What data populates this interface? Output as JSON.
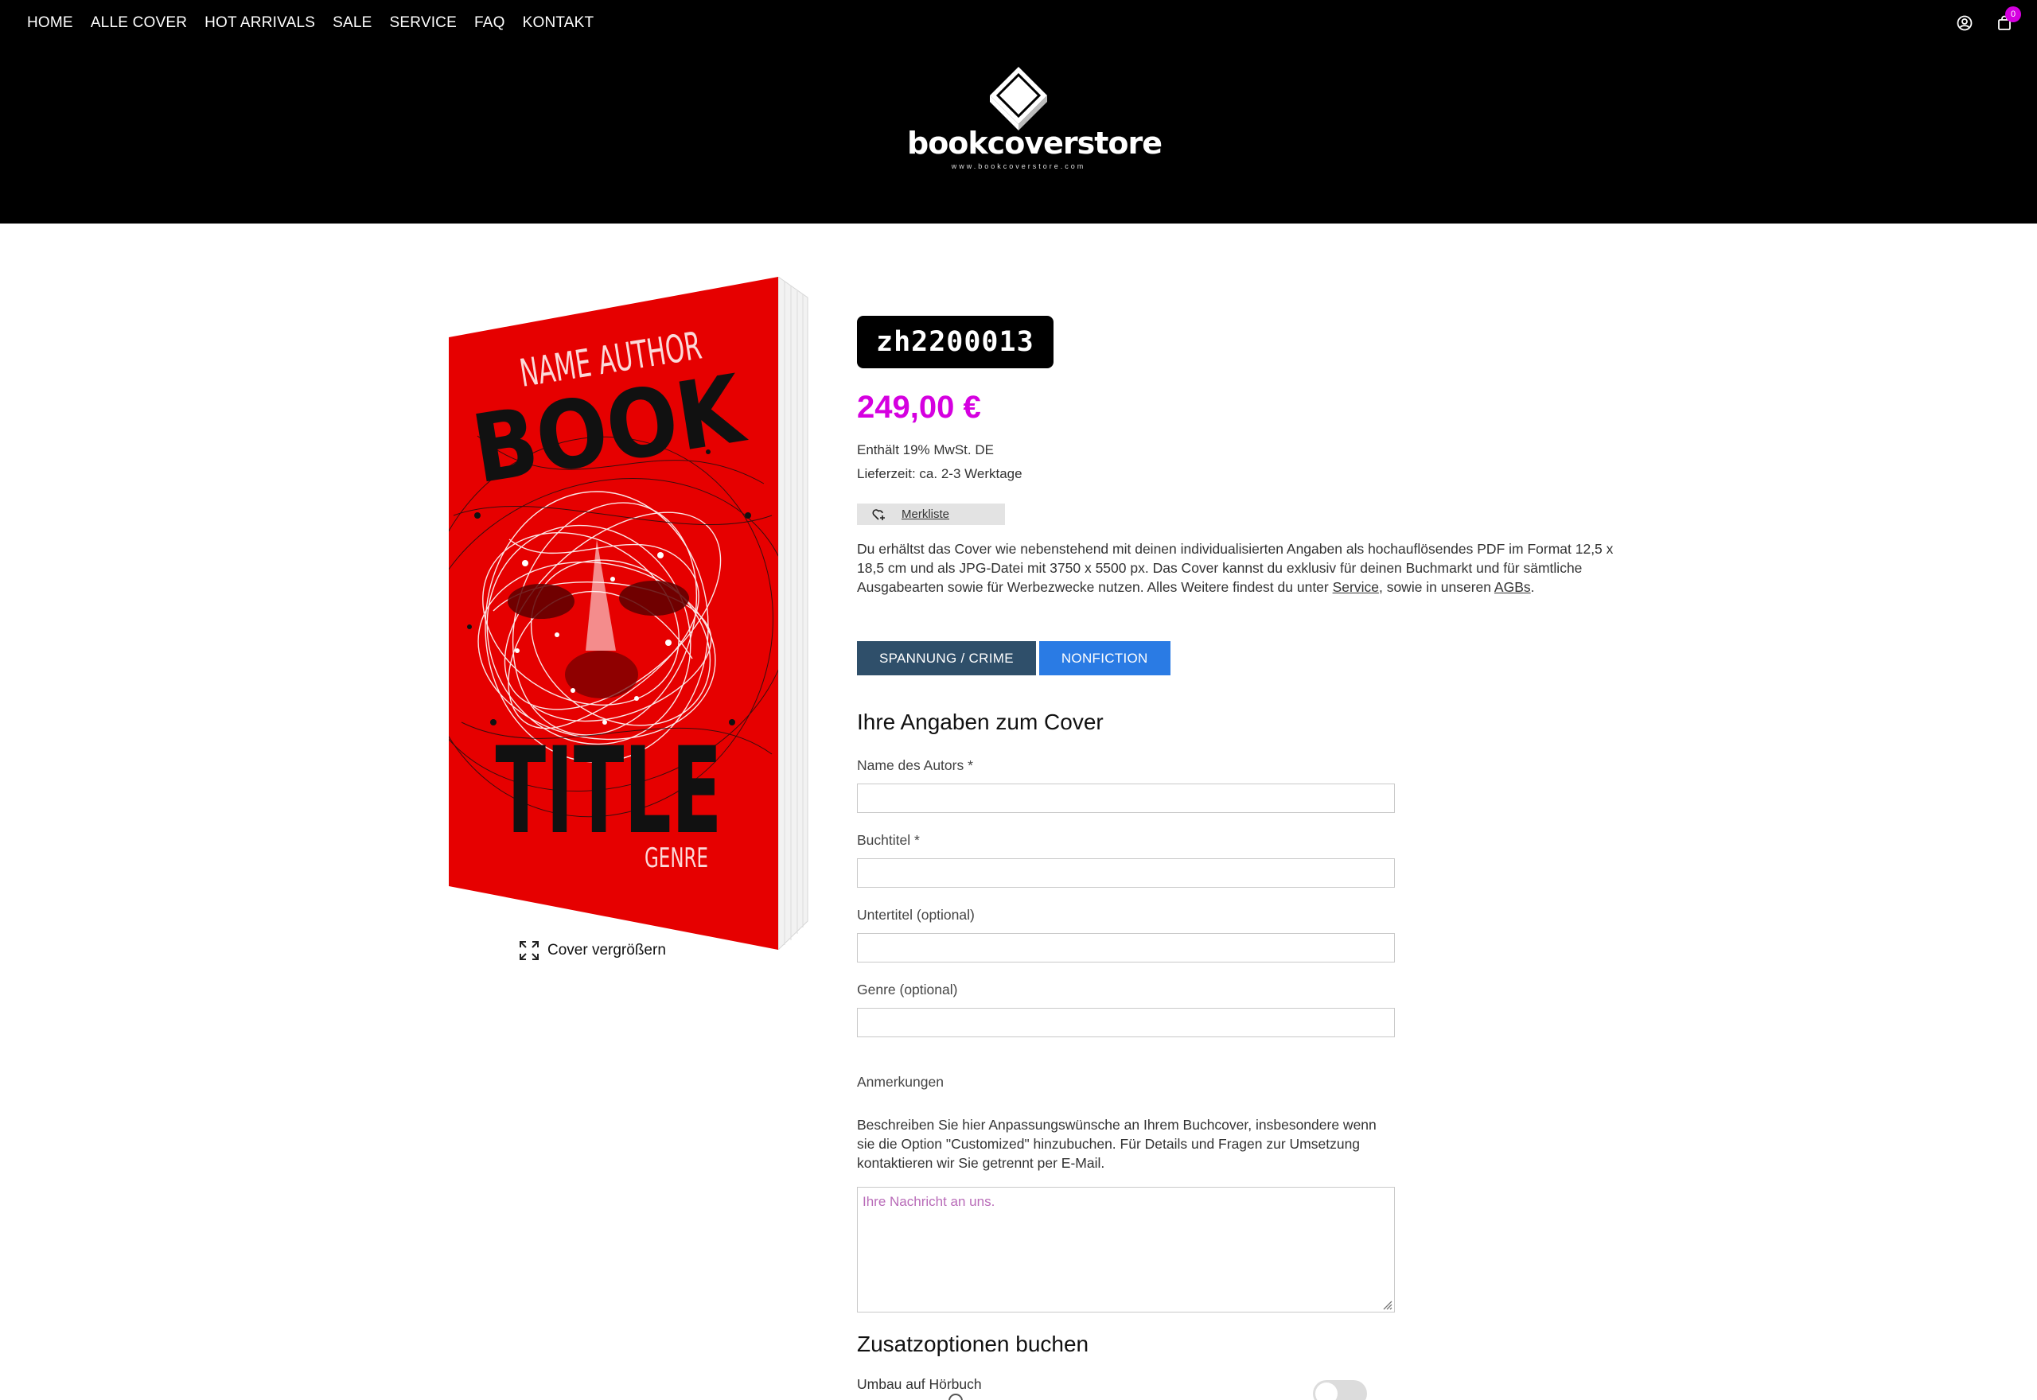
{
  "nav": {
    "items": [
      "HOME",
      "ALLE COVER",
      "HOT ARRIVALS",
      "SALE",
      "SERVICE",
      "FAQ",
      "KONTAKT"
    ]
  },
  "header": {
    "logo_text": "bookcoverstore",
    "logo_url": "www.bookcoverstore.com",
    "cart_count": "0",
    "icons": [
      "account-icon",
      "cart-icon"
    ]
  },
  "book": {
    "author": "NAME AUTHOR",
    "title_line1": "BOOK",
    "title_line2": "TITLE",
    "genre": "GENRE",
    "cover_color": "#e00000",
    "zoom_label": "Cover vergrößern"
  },
  "product": {
    "sku": "zh2200013",
    "price": "249,00 €",
    "price_color": "#d500e0",
    "tax": "Enthält 19% MwSt. DE",
    "delivery": "Lieferzeit: ca. 2-3 Werktage",
    "wishlist_label": "Merkliste",
    "description_1": "Du erhältst das Cover wie nebenstehend mit deinen individualisierten Angaben als hochauflösendes PDF im Format 12,5 x 18,5 cm und als JPG-Datei mit 3750 x 5500 px. Das Cover kannst du exklusiv für deinen Buchmarkt und für sämtliche Ausgabearten sowie für Werbezwecke nutzen. Alles Weitere findest du unter ",
    "service_link": "Service",
    "description_2": ", sowie in unseren ",
    "agb_link": "AGBs",
    "description_3": ".",
    "tags": [
      "SPANNUNG / CRIME",
      "NONFICTION"
    ]
  },
  "form": {
    "title": "Ihre Angaben zum Cover",
    "fields": [
      {
        "label": "Name des Autors *",
        "value": ""
      },
      {
        "label": "Buchtitel *",
        "value": ""
      },
      {
        "label": "Untertitel (optional)",
        "value": ""
      },
      {
        "label": "Genre (optional)",
        "value": ""
      }
    ],
    "remarks_label": "Anmerkungen",
    "remarks_help": "Beschreiben Sie hier Anpassungswünsche an Ihrem Buchcover, insbesondere wenn sie die Option \"Customized\" hinzubuchen. Für Details und Fragen zur Umsetzung kontaktieren wir Sie getrennt per E-Mail.",
    "remarks_placeholder": "Ihre Nachricht an uns."
  },
  "options": {
    "title": "Zusatzoptionen buchen",
    "items": [
      {
        "label": "Umbau auf Hörbuch",
        "enabled": false
      }
    ]
  }
}
